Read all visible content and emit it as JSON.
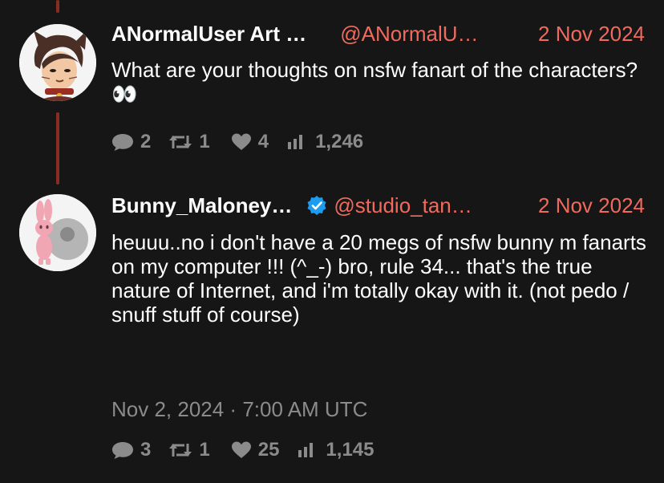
{
  "tweets": [
    {
      "author": "ANormalUser Art …",
      "handle": "@ANormalU…",
      "date": "2 Nov 2024",
      "text": "What are your thoughts on nsfw fanart of the characters? 👀",
      "stats": {
        "replies": "2",
        "retweets": "1",
        "likes": "4",
        "views": "1,246"
      }
    },
    {
      "author": "Bunny_Maloney…",
      "handle": "@studio_tan…",
      "date": "2 Nov 2024",
      "verified": true,
      "text": "heuuu..no  i don't have a 20 megs of nsfw bunny m fanarts on my computer !!!  (^_-)  bro, rule 34... that's the true nature of Internet, and i'm totally okay with it. (not pedo / snuff stuff of course)",
      "timestamp": "Nov 2, 2024 · 7:00 AM UTC",
      "stats": {
        "replies": "3",
        "retweets": "1",
        "likes": "25",
        "views": "1,145"
      }
    }
  ],
  "colors": {
    "accent": "#f06a5e",
    "thread_line": "#8a2c22",
    "muted": "#8b8b8b",
    "verified": "#1d9bf0",
    "background": "#161616"
  },
  "icons": {
    "reply": "speech-bubble-icon",
    "retweet": "retweet-icon",
    "like": "heart-icon",
    "views": "bar-chart-icon",
    "verified": "verified-badge-icon"
  }
}
